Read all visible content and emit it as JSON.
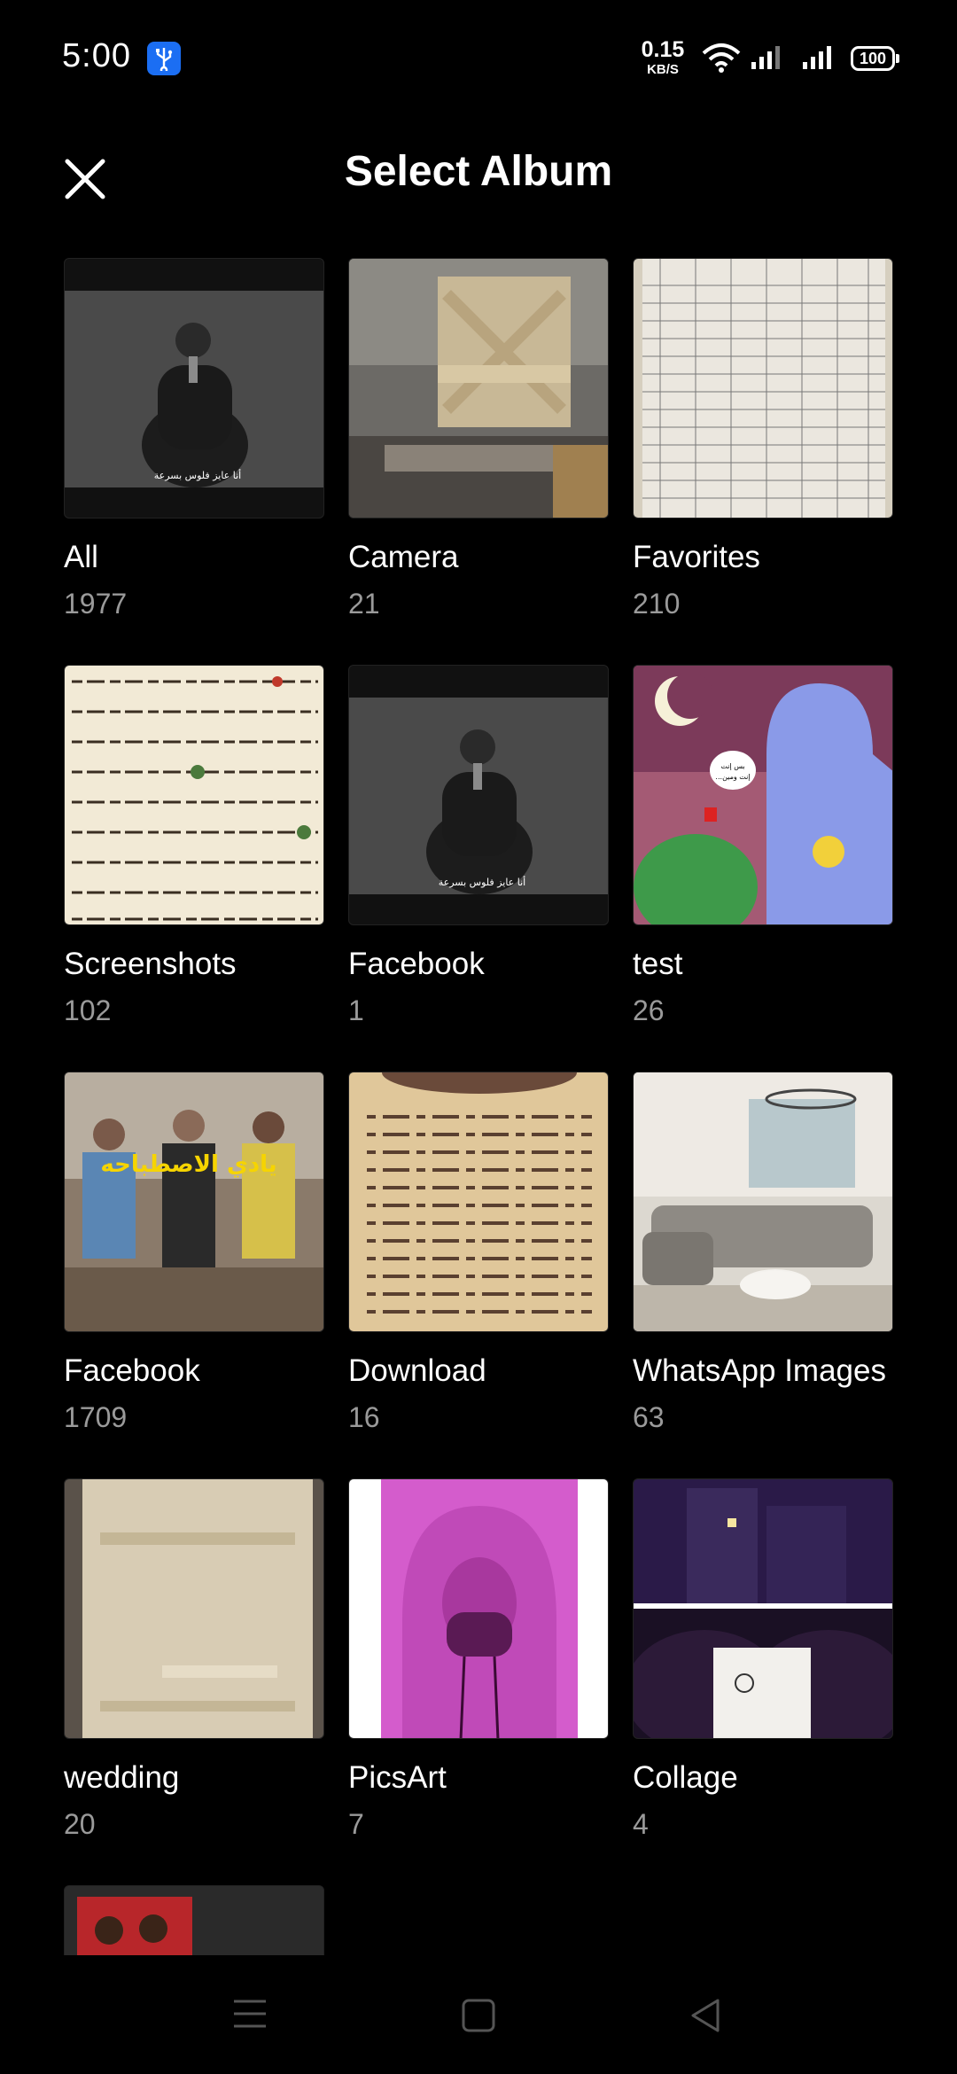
{
  "status_bar": {
    "time": "5:00",
    "net_speed_value": "0.15",
    "net_speed_unit": "KB/S",
    "battery": "100",
    "icons": [
      "usb-icon",
      "wifi-icon",
      "signal-icon",
      "signal-icon",
      "battery-icon"
    ]
  },
  "header": {
    "title": "Select Album",
    "close_icon": "close-icon"
  },
  "albums": [
    {
      "name": "All",
      "count": "1977"
    },
    {
      "name": "Camera",
      "count": "21"
    },
    {
      "name": "Favorites",
      "count": "210"
    },
    {
      "name": "Screenshots",
      "count": "102"
    },
    {
      "name": "Facebook",
      "count": "1"
    },
    {
      "name": "test",
      "count": "26"
    },
    {
      "name": "Facebook",
      "count": "1709"
    },
    {
      "name": "Download",
      "count": "16"
    },
    {
      "name": "WhatsApp Images",
      "count": "63"
    },
    {
      "name": "wedding",
      "count": "20"
    },
    {
      "name": "PicsArt",
      "count": "7"
    },
    {
      "name": "Collage",
      "count": "4"
    }
  ],
  "thumbnail_captions": {
    "all": "أنا عايز فلوس بسرعة",
    "facebook_1": "أنا عايز فلوس بسرعة",
    "test_bubble_1": "بس إنت",
    "test_bubble_2": "...إنت ومين",
    "facebook_1709": "يادي الاصطباحه"
  },
  "nav_bar": {
    "icons": [
      "menu-icon",
      "home-icon",
      "back-icon"
    ]
  },
  "colors": {
    "background": "#000000",
    "text_primary": "#ffffff",
    "text_secondary": "#9a9a9a",
    "usb_badge": "#1b6ef3"
  }
}
